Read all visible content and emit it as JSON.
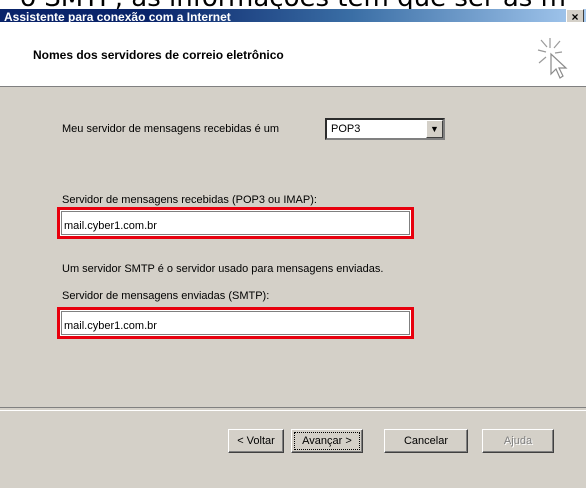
{
  "caption": {
    "text": "o SMTP, as informações tem que ser as m"
  },
  "window": {
    "title": "Assistente para conexão com a Internet",
    "close_glyph": "×"
  },
  "header": {
    "title": "Nomes dos servidores de correio eletrônico",
    "icon": "wizard-sparkle-cursor-icon"
  },
  "form": {
    "server_type_label": "Meu servidor de mensagens recebidas é um",
    "server_type_value": "POP3",
    "incoming_label": "Servidor de mensagens recebidas (POP3 ou IMAP):",
    "incoming_value": "mail.cyber1.com.br",
    "smtp_info": "Um servidor SMTP é o servidor usado para mensagens enviadas.",
    "outgoing_label": "Servidor de mensagens enviadas (SMTP):",
    "outgoing_value": "mail.cyber1.com.br",
    "highlight_color": "#e8000e"
  },
  "buttons": {
    "back": "< Voltar",
    "next": "Avançar >",
    "cancel": "Cancelar",
    "help": "Ajuda"
  }
}
